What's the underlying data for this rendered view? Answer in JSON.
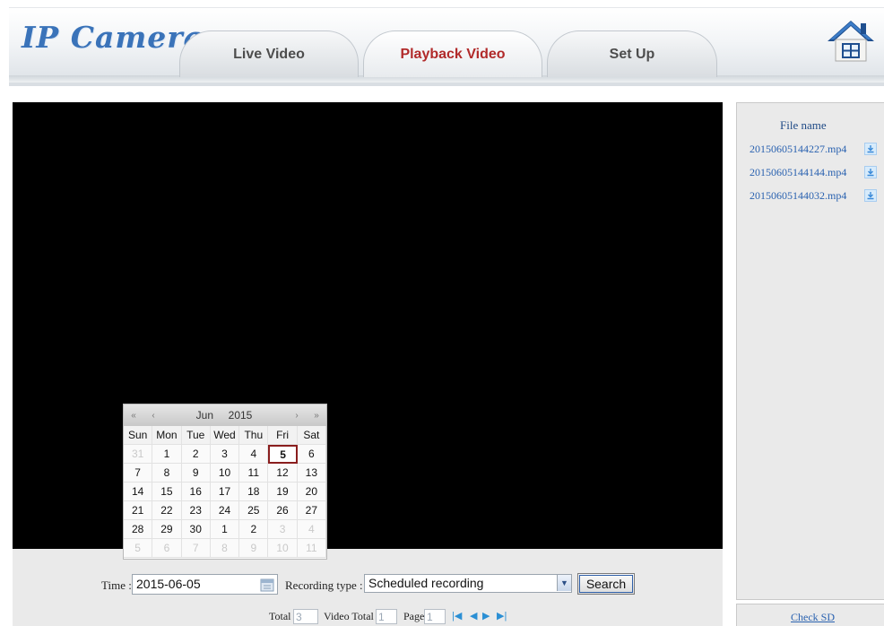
{
  "header": {
    "logo": "IP Camera",
    "tabs": [
      {
        "label": "Live Video",
        "active": false
      },
      {
        "label": "Playback Video",
        "active": true
      },
      {
        "label": "Set Up",
        "active": false
      }
    ],
    "home_icon": "home-icon"
  },
  "colors": {
    "accent": "#3a73b9",
    "active_tab_text": "#b12a2a",
    "link": "#2a62b0",
    "video_bg": "#000000",
    "panel_bg": "#eaeaea"
  },
  "calendar": {
    "prev_year": "«",
    "prev_month": "‹",
    "next_month": "›",
    "next_year": "»",
    "month": "Jun",
    "year": "2015",
    "weekdays": [
      "Sun",
      "Mon",
      "Tue",
      "Wed",
      "Thu",
      "Fri",
      "Sat"
    ],
    "days": [
      "31",
      "1",
      "2",
      "3",
      "4",
      "5",
      "6",
      "7",
      "8",
      "9",
      "10",
      "11",
      "12",
      "13",
      "14",
      "15",
      "16",
      "17",
      "18",
      "19",
      "20",
      "21",
      "22",
      "23",
      "24",
      "25",
      "26",
      "27",
      "28",
      "29",
      "30",
      "1",
      "2",
      "3",
      "4",
      "5",
      "6",
      "7",
      "8",
      "9",
      "10",
      "11"
    ],
    "selected_day": "5"
  },
  "search": {
    "time_label": "Time :",
    "time_value": "2015-06-05",
    "recording_type_label": "Recording type :",
    "recording_type_value": "Scheduled recording",
    "search_button": "Search"
  },
  "pager": {
    "total_label": "Total",
    "total_value": "3",
    "video_total_label": "Video Total",
    "video_total_value": "1",
    "page_label": "Page",
    "page_value": "1"
  },
  "files": {
    "title": "File name",
    "items": [
      {
        "name": "20150605144227.mp4"
      },
      {
        "name": "20150605144144.mp4"
      },
      {
        "name": "20150605144032.mp4"
      }
    ],
    "check_sd": "Check  SD"
  }
}
